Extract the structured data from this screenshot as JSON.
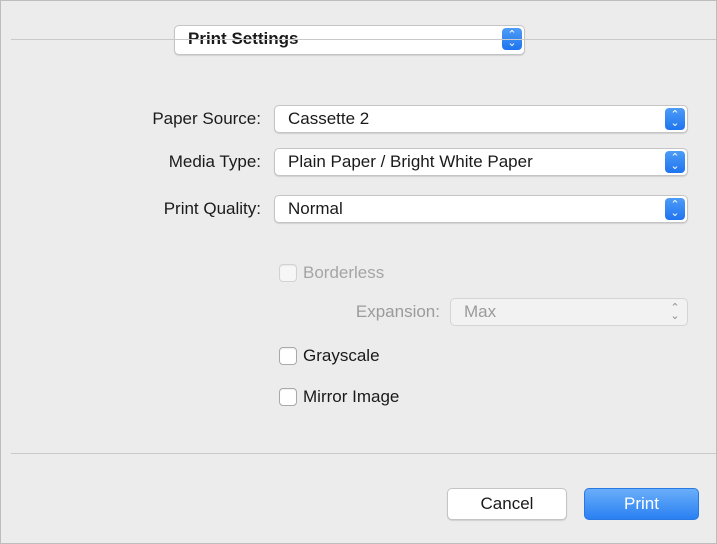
{
  "panel_selector": {
    "value": "Print Settings"
  },
  "fields": {
    "paper_source": {
      "label": "Paper Source:",
      "value": "Cassette 2"
    },
    "media_type": {
      "label": "Media Type:",
      "value": "Plain Paper / Bright White Paper"
    },
    "print_quality": {
      "label": "Print Quality:",
      "value": "Normal"
    }
  },
  "options": {
    "borderless": {
      "label": "Borderless",
      "checked": false,
      "enabled": false
    },
    "expansion": {
      "label": "Expansion:",
      "value": "Max",
      "enabled": false
    },
    "grayscale": {
      "label": "Grayscale",
      "checked": false,
      "enabled": true
    },
    "mirror_image": {
      "label": "Mirror Image",
      "checked": false,
      "enabled": true
    }
  },
  "buttons": {
    "cancel": "Cancel",
    "print": "Print"
  },
  "colors": {
    "accent": "#1f74ef",
    "background": "#ececec",
    "disabled_text": "#9b9b9b"
  },
  "icons": {
    "popup_arrows": "up-down-chevron-icon"
  }
}
